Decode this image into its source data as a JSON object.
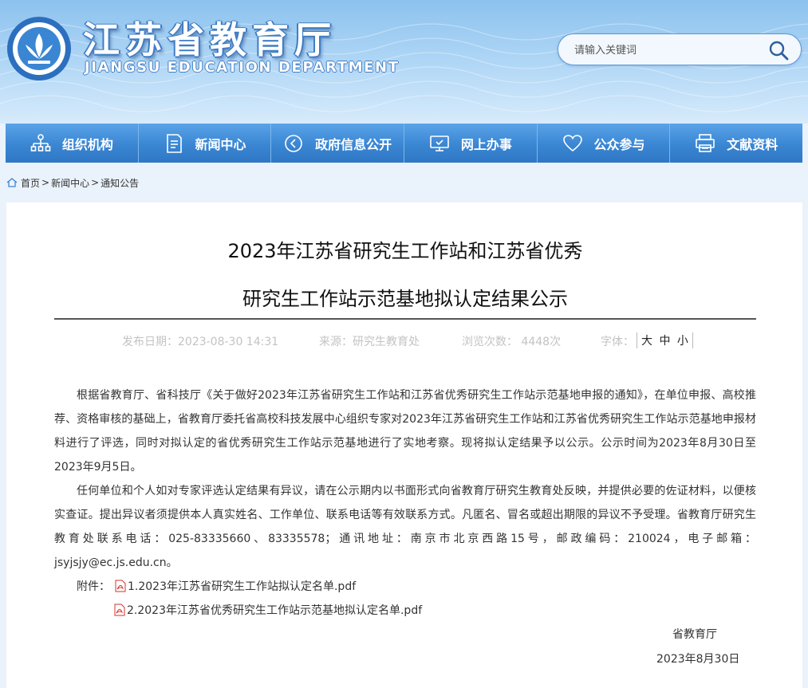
{
  "header": {
    "site_title": "江苏省教育厅",
    "site_subtitle": "JIANGSU EDUCATION DEPARTMENT",
    "logo_icon": "jiangsu-education-logo",
    "search_placeholder": "请输入关键词",
    "search_icon": "search-icon"
  },
  "nav": {
    "items": [
      {
        "label": "组织机构",
        "icon": "org-chart-icon"
      },
      {
        "label": "新闻中心",
        "icon": "news-document-icon"
      },
      {
        "label": "政府信息公开",
        "icon": "info-disclosure-icon"
      },
      {
        "label": "网上办事",
        "icon": "monitor-icon"
      },
      {
        "label": "公众参与",
        "icon": "heart-icon"
      },
      {
        "label": "文献资料",
        "icon": "printer-icon"
      }
    ]
  },
  "breadcrumb": {
    "home": "首页",
    "news": "新闻中心",
    "current": "通知公告",
    "separator": ">"
  },
  "article": {
    "title_line1": "2023年江苏省研究生工作站和江苏省优秀",
    "title_line2": "研究生工作站示范基地拟认定结果公示",
    "meta": {
      "date": "发布日期：2023-08-30 14:31",
      "source": "来源：研究生教育处",
      "views": "浏览次数：  4448次",
      "font_label": "字体：",
      "font_large": "大",
      "font_medium": "中",
      "font_small": "小"
    },
    "paragraphs": [
      "根据省教育厅、省科技厅《关于做好2023年江苏省研究生工作站和江苏省优秀研究生工作站示范基地申报的通知》，在单位申报、高校推荐、资格审核的基础上，省教育厅委托省高校科技发展中心组织专家对2023年江苏省研究生工作站和江苏省优秀研究生工作站示范基地申报材料进行了评选，同时对拟认定的省优秀研究生工作站示范基地进行了实地考察。现将拟认定结果予以公示。公示时间为2023年8月30日至2023年9月5日。",
      "任何单位和个人如对专家评选认定结果有异议，请在公示期内以书面形式向省教育厅研究生教育处反映，并提供必要的佐证材料，以便核实查证。提出异议者须提供本人真实姓名、工作单位、联系电话等有效联系方式。凡匿名、冒名或超出期限的异议不予受理。省教育厅研究生教育处联系电话：025-83335660、83335578；通讯地址：南京市北京西路15号，邮政编码：210024，电子邮箱：jsyjsjy@ec.js.edu.cn。"
    ],
    "attachments_label": "附件：",
    "attachments": [
      "1.2023年江苏省研究生工作站拟认定名单.pdf",
      "2.2023年江苏省优秀研究生工作站示范基地拟认定名单.pdf"
    ],
    "signature": "省教育厅",
    "sign_date": "2023年8月30日"
  },
  "colors": {
    "nav_blue": "#3a86d3",
    "header_blue": "#8cc2ee",
    "meta_grey": "#c3c3c3",
    "pdf_red": "#d9302c"
  }
}
